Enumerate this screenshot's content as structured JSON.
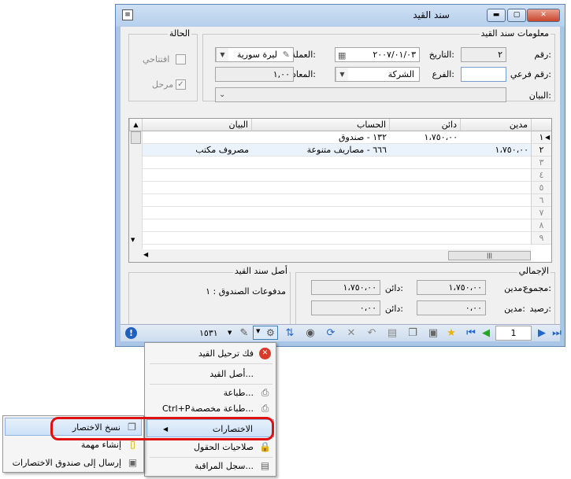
{
  "window": {
    "title": "سند القيد"
  },
  "info_group": {
    "label": "معلومات سند القيد",
    "number_label": "رقم:",
    "number_value": "٢",
    "date_label": "التاريخ:",
    "date_value": "٢٠٠٧/٠١/٠٣",
    "currency_label": "العملة:",
    "currency_value": "ليرة سورية",
    "subnumber_label": "رقم فرعي:",
    "subnumber_value": "",
    "branch_label": "الفرع:",
    "branch_value": "الشركة",
    "rate_label": "المعادل:",
    "rate_value": "١,٠٠",
    "statement_label": "البيان:",
    "statement_value": ""
  },
  "status_group": {
    "label": "الحالة",
    "opening_label": "افتتاحي",
    "opening_checked": false,
    "posted_label": "مرحل",
    "posted_checked": true
  },
  "grid": {
    "headers": {
      "debit": "مدين",
      "credit": "دائن",
      "account": "الحساب",
      "statement": "البيان"
    },
    "rows": [
      {
        "n": "١",
        "debit": "",
        "credit": "١،٧٥٠،٠٠",
        "account": "١٣٢ - صندوق",
        "statement": ""
      },
      {
        "n": "٢",
        "debit": "١،٧٥٠،٠٠",
        "credit": "",
        "account": "٦٦٦ - مصاريف متنوعة",
        "statement": "مصروف مكتب"
      },
      {
        "n": "٣"
      },
      {
        "n": "٤"
      },
      {
        "n": "٥"
      },
      {
        "n": "٦"
      },
      {
        "n": "٧"
      },
      {
        "n": "٨"
      },
      {
        "n": "٩"
      }
    ]
  },
  "totals_group": {
    "label": "الإجمالي",
    "sum_label": "مجموع:",
    "balance_label": "رصيد:",
    "debit_label": "مدين:",
    "credit_label": "دائن:",
    "sum_debit": "١،٧٥٠،٠٠",
    "sum_credit": "١،٧٥٠،٠٠",
    "bal_debit": "٠،٠٠",
    "bal_credit": "٠،٠٠"
  },
  "source_group": {
    "label": "أصل سند القيد",
    "value": "مدفوعات الصندوق : ١"
  },
  "toolbar": {
    "record_position": "1",
    "record_number": "١٥٣١"
  },
  "menu": {
    "unpost": "فك ترحيل القيد",
    "source": "أصل القيد...",
    "print": "طباعة...",
    "custom_print": "طباعة مخصصة...",
    "custom_print_shortcut": "Ctrl+P",
    "shortcuts": "الاختصارات",
    "field_permissions": "صلاحيات الحقول",
    "audit_log": "سجل المراقبة..."
  },
  "submenu": {
    "copy_shortcut": "نسخ الاختصار",
    "create_task": "إنشاء مهمة",
    "send_to_box": "إرسال إلى صندوق الاختصارات"
  },
  "colors": {
    "highlight_ring": "#e01010",
    "window_frame": "#a9c6e6"
  }
}
